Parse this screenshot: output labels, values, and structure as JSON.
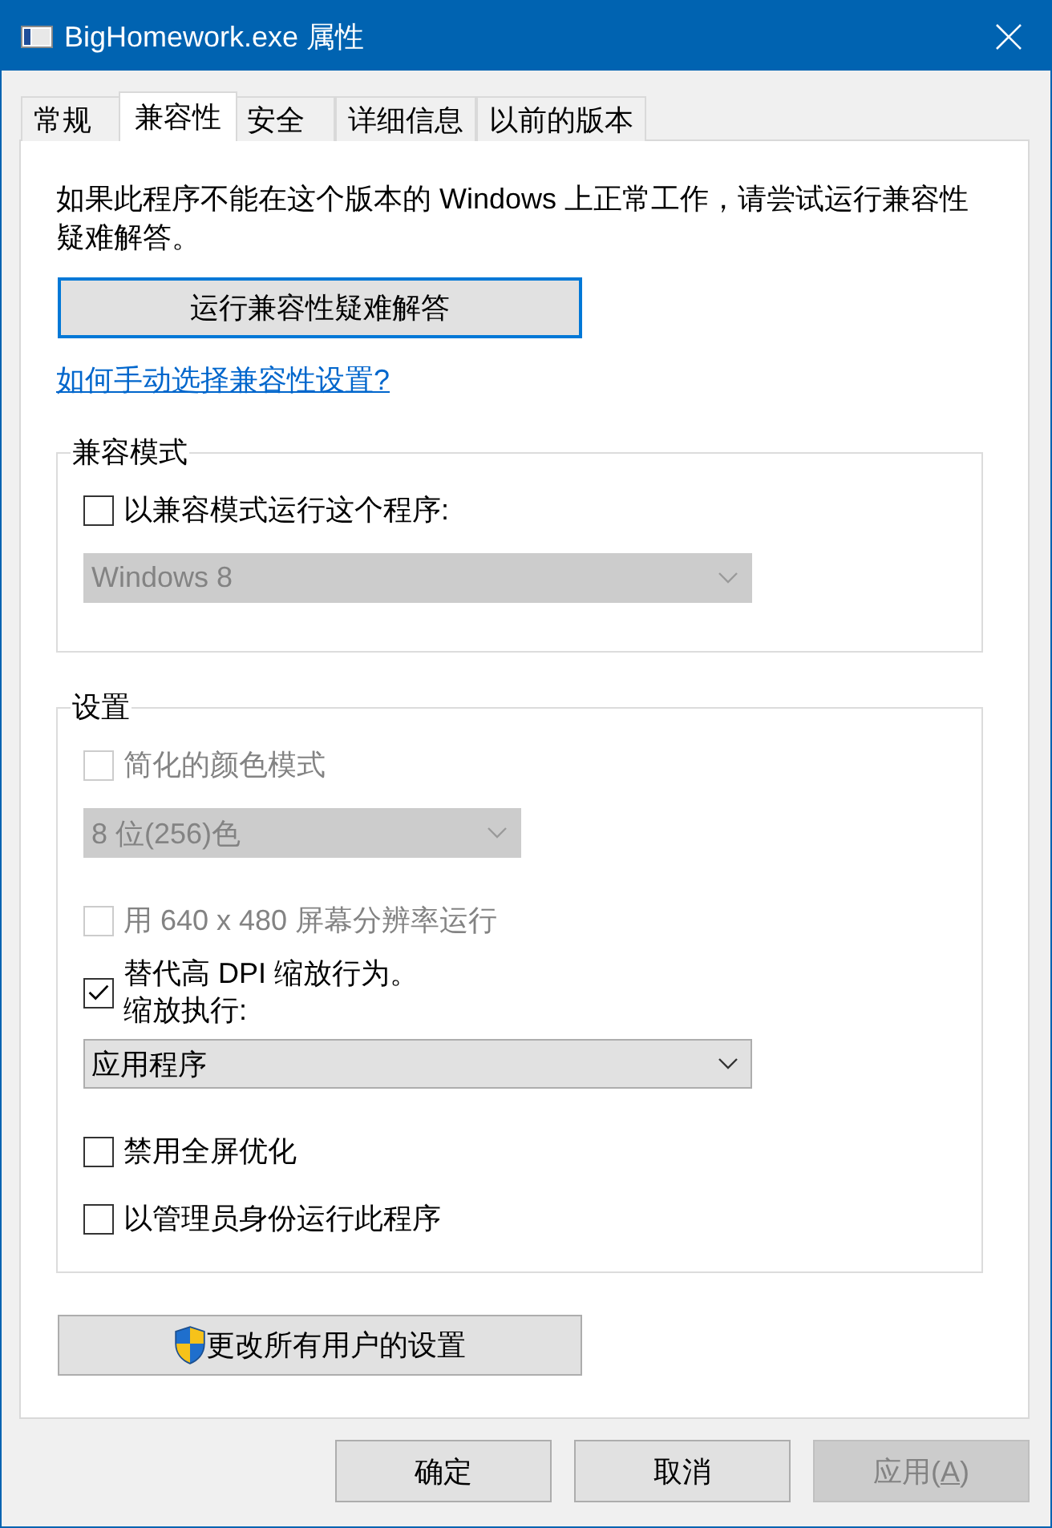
{
  "window": {
    "title": "BigHomework.exe 属性"
  },
  "tabs": [
    {
      "label": "常规",
      "selected": false
    },
    {
      "label": "兼容性",
      "selected": true
    },
    {
      "label": "安全",
      "selected": false
    },
    {
      "label": "详细信息",
      "selected": false
    },
    {
      "label": "以前的版本",
      "selected": false
    }
  ],
  "page": {
    "intro": "如果此程序不能在这个版本的 Windows 上正常工作，请尝试运行兼容性疑难解答。",
    "troubleshoot_button": {
      "label": "运行兼容性疑难解答",
      "focused": true
    },
    "help_link": "如何手动选择兼容性设置?",
    "groups": [
      {
        "title": "兼容模式",
        "items": [
          {
            "kind": "checkbox",
            "label": "以兼容模式运行这个程序:",
            "checked": false,
            "disabled": false
          },
          {
            "kind": "dropdown",
            "value": "Windows 8",
            "disabled": true
          }
        ]
      },
      {
        "title": "设置",
        "items": [
          {
            "kind": "checkbox",
            "label": "简化的颜色模式",
            "checked": false,
            "disabled": true
          },
          {
            "kind": "dropdown",
            "value": "8 位(256)色",
            "disabled": true
          },
          {
            "kind": "checkbox",
            "label": "用 640 x 480 屏幕分辨率运行",
            "checked": false,
            "disabled": true
          },
          {
            "kind": "checkbox",
            "label": "替代高 DPI 缩放行为。",
            "note": "缩放执行:",
            "checked": true,
            "disabled": false
          },
          {
            "kind": "dropdown",
            "value": "应用程序",
            "disabled": false
          },
          {
            "kind": "checkbox",
            "label": "禁用全屏优化",
            "checked": false,
            "disabled": false
          },
          {
            "kind": "checkbox",
            "label": "以管理员身份运行此程序",
            "checked": false,
            "disabled": false
          }
        ]
      }
    ],
    "all_users_button": {
      "label": "更改所有用户的设置"
    }
  },
  "buttons": [
    {
      "label": "确定",
      "disabled": false
    },
    {
      "label": "取消",
      "disabled": false
    },
    {
      "label": "应用(A)",
      "disabled": true,
      "mnemonic_underlined": true
    }
  ]
}
